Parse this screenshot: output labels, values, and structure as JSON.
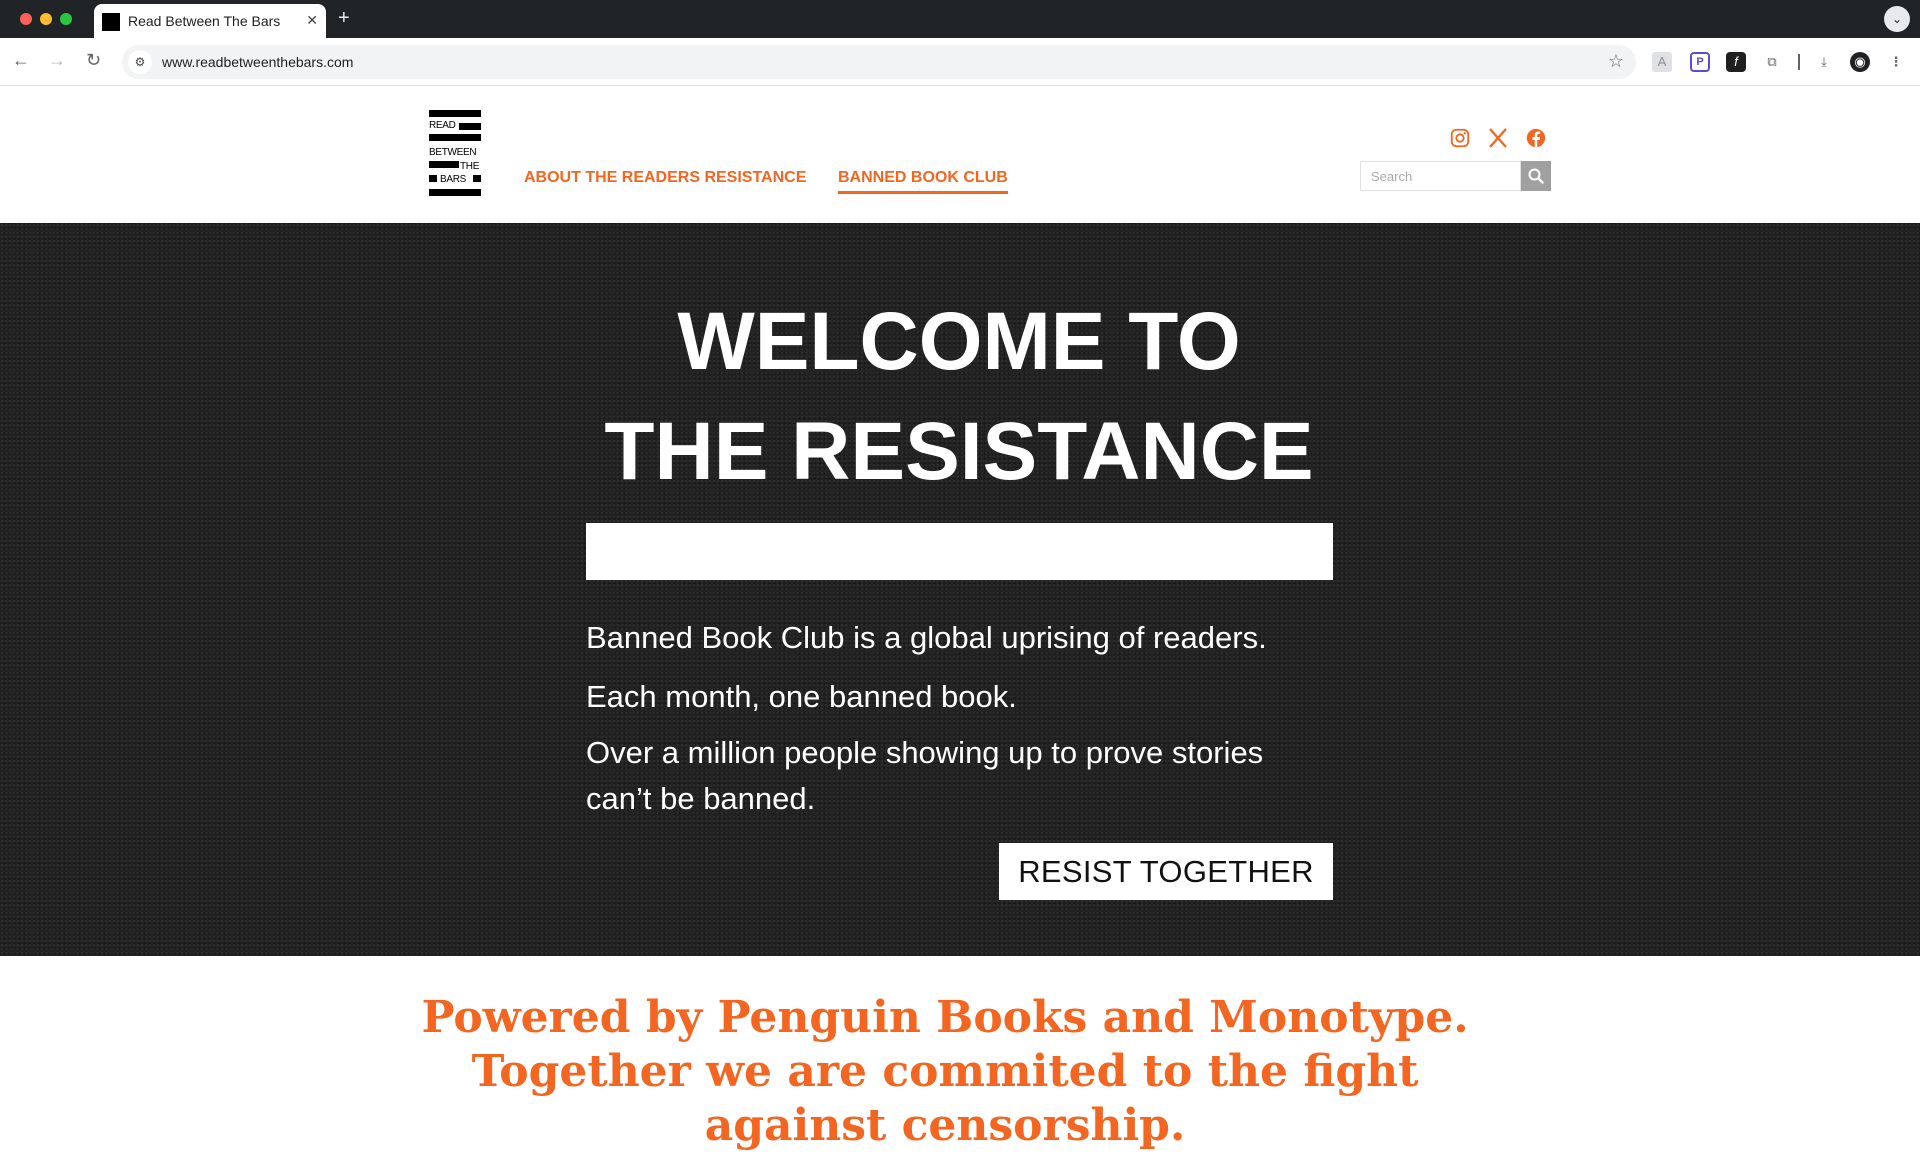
{
  "browser": {
    "tab_title": "Read Between The Bars",
    "tab_close": "✕",
    "new_tab": "+",
    "url": "www.readbetweenthebars.com",
    "tab_menu": "⌄"
  },
  "site": {
    "logo": {
      "line1": "READ",
      "line2": "BETWEEN",
      "line3": "THE",
      "line4": "BARS"
    },
    "nav": {
      "about": "ABOUT THE READERS RESISTANCE",
      "banned_book_club": "BANNED BOOK CLUB",
      "active": "banned_book_club"
    },
    "social": [
      "instagram-icon",
      "x-icon",
      "facebook-icon"
    ],
    "search": {
      "placeholder": "Search",
      "value": ""
    },
    "accent_color": "#f26622"
  },
  "hero": {
    "title_line1": "WELCOME TO",
    "title_line2": "THE RESISTANCE",
    "paragraph1": "Banned Book Club is a global uprising of readers.",
    "paragraph2": "Each month, one banned book.",
    "paragraph3": "Over a million people showing up to prove stories can’t be banned.",
    "cta": "RESIST TOGETHER"
  },
  "powered": {
    "line1": "Powered by Penguin Books and Monotype.",
    "line2": "Together we are commited to the fight",
    "line3": "against censorship."
  }
}
